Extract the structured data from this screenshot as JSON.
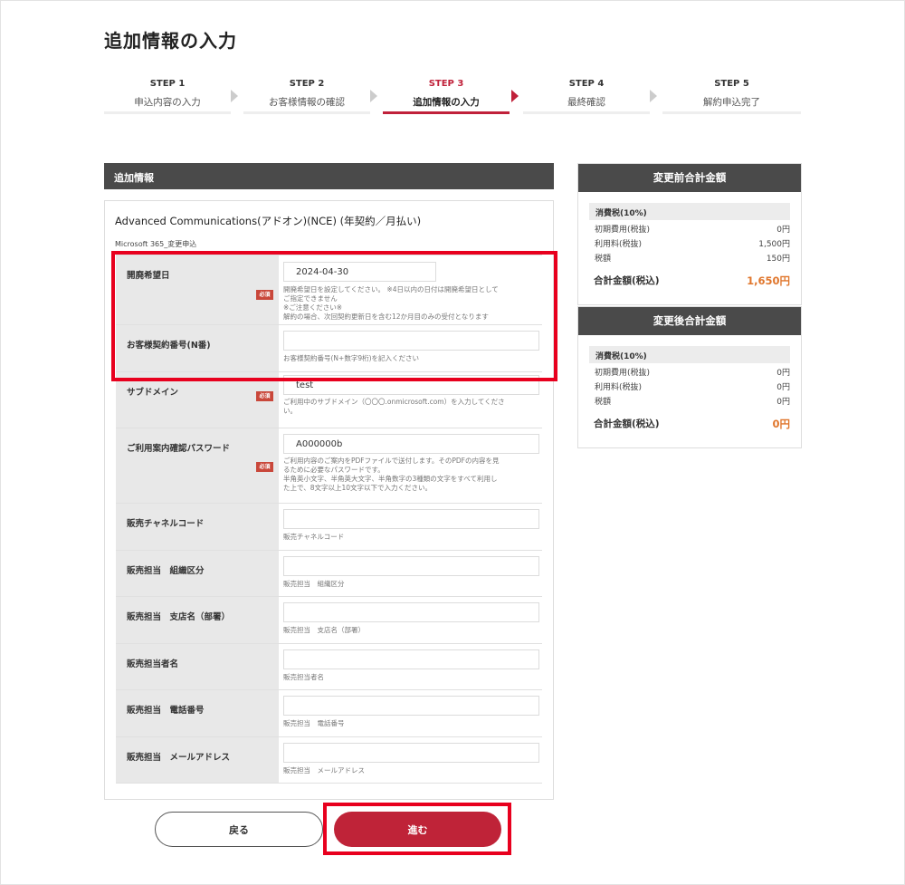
{
  "page_title": "追加情報の入力",
  "steps": [
    {
      "num": "STEP 1",
      "label": "申込内容の入力"
    },
    {
      "num": "STEP 2",
      "label": "お客様情報の確認"
    },
    {
      "num": "STEP 3",
      "label": "追加情報の入力"
    },
    {
      "num": "STEP 4",
      "label": "最終確認"
    },
    {
      "num": "STEP 5",
      "label": "解約申込完了"
    }
  ],
  "active_step": 3,
  "form": {
    "section_title": "追加情報",
    "product_title": "Advanced Communications(アドオン)(NCE) (年契約／月払い)",
    "product_sub": "Microsoft 365_変更申込",
    "required_badge": "必須",
    "fields": [
      {
        "label": "開廃希望日",
        "required": true,
        "value": "2024-04-30",
        "placeholder": "",
        "help": [
          "開廃希望日を設定してください。 ※4日以内の日付は開廃希望日として",
          "ご指定できません",
          "※ご注意ください※",
          "解約の場合、次回契約更新日を含む12か月目のみの受付となります"
        ]
      },
      {
        "label": "お客様契約番号(N番)",
        "required": false,
        "value": "",
        "placeholder": "",
        "help": [
          "お客様契約番号(N+数字9桁)を記入ください"
        ]
      },
      {
        "label": "サブドメイン",
        "required": true,
        "value": "test",
        "placeholder": "",
        "help": [
          "ご利用中のサブドメイン（〇〇〇.onmicrosoft.com）を入力してくださ",
          "い。"
        ]
      },
      {
        "label": "ご利用案内確認パスワード",
        "required": true,
        "value": "A000000b",
        "placeholder": "",
        "help": [
          "ご利用内容のご案内をPDFファイルで送付します。そのPDFの内容を見",
          "るために必要なパスワードです。",
          "半角英小文字、半角英大文字、半角数字の3種類の文字をすべて利用し",
          "た上で、8文字以上10文字以下で入力ください。"
        ]
      },
      {
        "label": "販売チャネルコード",
        "required": false,
        "value": "",
        "placeholder": "",
        "help": [
          "販売チャネルコード"
        ]
      },
      {
        "label": "販売担当　組織区分",
        "required": false,
        "value": "",
        "placeholder": "",
        "help": [
          "販売担当　組織区分"
        ]
      },
      {
        "label": "販売担当　支店名（部署）",
        "required": false,
        "value": "",
        "placeholder": "",
        "help": [
          "販売担当　支店名（部署）"
        ]
      },
      {
        "label": "販売担当者名",
        "required": false,
        "value": "",
        "placeholder": "",
        "help": [
          "販売担当者名"
        ]
      },
      {
        "label": "販売担当　電話番号",
        "required": false,
        "value": "",
        "placeholder": "",
        "help": [
          "販売担当　電話番号"
        ]
      },
      {
        "label": "販売担当　メールアドレス",
        "required": false,
        "value": "",
        "placeholder": "",
        "help": [
          "販売担当　メールアドレス"
        ]
      }
    ]
  },
  "summary_before": {
    "title": "変更前合計金額",
    "tax_label": "消費税(10%)",
    "lines": [
      {
        "label": "初期費用(税抜)",
        "value": "0円"
      },
      {
        "label": "利用料(税抜)",
        "value": "1,500円"
      },
      {
        "label": "税額",
        "value": "150円"
      }
    ],
    "total_label": "合計金額(税込)",
    "total_value": "1,650円"
  },
  "summary_after": {
    "title": "変更後合計金額",
    "tax_label": "消費税(10%)",
    "lines": [
      {
        "label": "初期費用(税抜)",
        "value": "0円"
      },
      {
        "label": "利用料(税抜)",
        "value": "0円"
      },
      {
        "label": "税額",
        "value": "0円"
      }
    ],
    "total_label": "合計金額(税込)",
    "total_value": "0円"
  },
  "buttons": {
    "back": "戻る",
    "next": "進む"
  },
  "colors": {
    "accent": "#c0213a",
    "header": "#4a4a4a",
    "total": "#e0762c",
    "highlight": "#e8001e"
  }
}
